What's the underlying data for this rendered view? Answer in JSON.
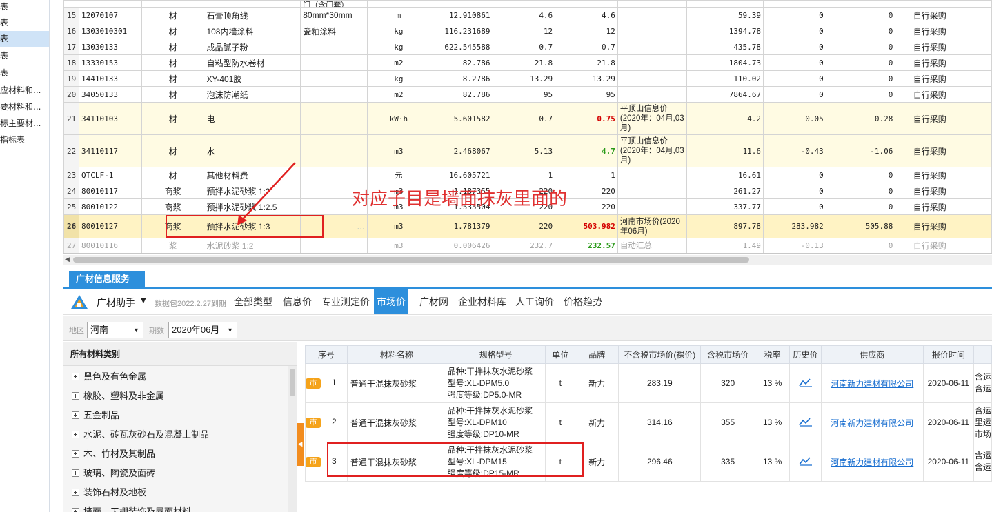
{
  "left_nav": {
    "items": [
      "表",
      "表",
      "表",
      "表",
      "表",
      "应材料和...",
      "要材料和...",
      "标主要材...",
      "指标表"
    ],
    "active_index": 2
  },
  "grid": {
    "partial_top": {
      "spec": "门（含门套）"
    },
    "rows": [
      {
        "idx": "15",
        "code": "12070107",
        "type": "材",
        "name": "石膏顶角线",
        "spec": "80mm*30mm",
        "unit": "m",
        "qty": "12.910861",
        "price1": "4.6",
        "price2": "4.6",
        "source": "",
        "amount": "59.39",
        "diff": "0",
        "diff_total": "0",
        "supply": "自行采购",
        "style": ""
      },
      {
        "idx": "16",
        "code": "1303010301",
        "type": "材",
        "name": "108内墙涂料",
        "spec": "瓷釉涂料",
        "unit": "kg",
        "qty": "116.231689",
        "price1": "12",
        "price2": "12",
        "source": "",
        "amount": "1394.78",
        "diff": "0",
        "diff_total": "0",
        "supply": "自行采购",
        "style": ""
      },
      {
        "idx": "17",
        "code": "13030133",
        "type": "材",
        "name": "成品腻子粉",
        "spec": "",
        "unit": "kg",
        "qty": "622.545588",
        "price1": "0.7",
        "price2": "0.7",
        "source": "",
        "amount": "435.78",
        "diff": "0",
        "diff_total": "0",
        "supply": "自行采购",
        "style": ""
      },
      {
        "idx": "18",
        "code": "13330153",
        "type": "材",
        "name": "自粘型防水卷材",
        "spec": "",
        "unit": "m2",
        "qty": "82.786",
        "price1": "21.8",
        "price2": "21.8",
        "source": "",
        "amount": "1804.73",
        "diff": "0",
        "diff_total": "0",
        "supply": "自行采购",
        "style": ""
      },
      {
        "idx": "19",
        "code": "14410133",
        "type": "材",
        "name": "XY-401胶",
        "spec": "",
        "unit": "kg",
        "qty": "8.2786",
        "price1": "13.29",
        "price2": "13.29",
        "source": "",
        "amount": "110.02",
        "diff": "0",
        "diff_total": "0",
        "supply": "自行采购",
        "style": ""
      },
      {
        "idx": "20",
        "code": "34050133",
        "type": "材",
        "name": "泡沫防潮纸",
        "spec": "",
        "unit": "m2",
        "qty": "82.786",
        "price1": "95",
        "price2": "95",
        "source": "",
        "amount": "7864.67",
        "diff": "0",
        "diff_total": "0",
        "supply": "自行采购",
        "style": ""
      },
      {
        "idx": "21",
        "code": "34110103",
        "type": "材",
        "name": "电",
        "spec": "",
        "unit": "kW·h",
        "qty": "5.601582",
        "price1": "0.7",
        "price2": "0.75",
        "source": "平顶山信息价(2020年：04月,03月)",
        "amount": "4.2",
        "diff": "0.05",
        "diff_total": "0.28",
        "supply": "自行采购",
        "style": "yellow",
        "p2color": "red"
      },
      {
        "idx": "22",
        "code": "34110117",
        "type": "材",
        "name": "水",
        "spec": "",
        "unit": "m3",
        "qty": "2.468067",
        "price1": "5.13",
        "price2": "4.7",
        "source": "平顶山信息价(2020年：04月,03月)",
        "amount": "11.6",
        "diff": "-0.43",
        "diff_total": "-1.06",
        "supply": "自行采购",
        "style": "yellow",
        "p2color": "green"
      },
      {
        "idx": "23",
        "code": "QTCLF-1",
        "type": "材",
        "name": "其他材料费",
        "spec": "",
        "unit": "元",
        "qty": "16.605721",
        "price1": "1",
        "price2": "1",
        "source": "",
        "amount": "16.61",
        "diff": "0",
        "diff_total": "0",
        "supply": "自行采购",
        "style": ""
      },
      {
        "idx": "24",
        "code": "80010117",
        "type": "商浆",
        "name": "预拌水泥砂浆 1:2",
        "spec": "",
        "unit": "m3",
        "qty": "1.187355",
        "price1": "220",
        "price2": "220",
        "source": "",
        "amount": "261.27",
        "diff": "0",
        "diff_total": "0",
        "supply": "自行采购",
        "style": ""
      },
      {
        "idx": "25",
        "code": "80010122",
        "type": "商浆",
        "name": "预拌水泥砂浆 1:2.5",
        "spec": "",
        "unit": "m3",
        "qty": "1.535504",
        "price1": "220",
        "price2": "220",
        "source": "",
        "amount": "337.77",
        "diff": "0",
        "diff_total": "0",
        "supply": "自行采购",
        "style": ""
      },
      {
        "idx": "26",
        "code": "80010127",
        "type": "商浆",
        "name": "预拌水泥砂浆 1:3",
        "spec": "…",
        "unit": "m3",
        "qty": "1.781379",
        "price1": "220",
        "price2": "503.982",
        "source": "河南市场价(2020年06月)",
        "amount": "897.78",
        "diff": "283.982",
        "diff_total": "505.88",
        "supply": "自行采购",
        "style": "selected",
        "p2color": "red"
      },
      {
        "idx": "27",
        "code": "80010116",
        "type": "浆",
        "name": "水泥砂浆 1:2",
        "spec": "",
        "unit": "m3",
        "qty": "0.006426",
        "price1": "232.7",
        "price2": "232.57",
        "source": "自动汇总",
        "amount": "1.49",
        "diff": "-0.13",
        "diff_total": "0",
        "supply": "自行采购",
        "style": "gray",
        "p2color": "green"
      }
    ]
  },
  "annotation": {
    "text": "对应子目是墙面抹灰里面的"
  },
  "service": {
    "tab_label": "广材信息服务",
    "helper_label": "广材助手",
    "package_note": "数据包2022.2.27到期",
    "tabs": [
      "全部类型",
      "信息价",
      "专业测定价",
      "市场价",
      "广材网",
      "企业材料库",
      "人工询价",
      "价格趋势"
    ],
    "active_tab": 3,
    "filter": {
      "region_label": "地区",
      "region_value": "河南",
      "period_label": "期数",
      "period_value": "2020年06月"
    }
  },
  "categories": {
    "header": "所有材料类别",
    "items": [
      "黑色及有色金属",
      "橡胶、塑料及非金属",
      "五金制品",
      "水泥、砖瓦灰砂石及混凝土制品",
      "木、竹材及其制品",
      "玻璃、陶瓷及面砖",
      "装饰石材及地板",
      "墙面、天棚装饰及屋面材料"
    ]
  },
  "results": {
    "headers": [
      "序号",
      "材料名称",
      "规格型号",
      "单位",
      "品牌",
      "不含税市场价(裸价)",
      "含税市场价",
      "税率",
      "历史价",
      "供应商",
      "报价时间",
      ""
    ],
    "badge": "市",
    "rows": [
      {
        "no": "1",
        "name": "普通干混抹灰砂浆",
        "spec": [
          "品种:干拌抹灰水泥砂浆",
          "型号:XL-DPM5.0",
          "强度等级:DP5.0-MR"
        ],
        "unit": "t",
        "brand": "新力",
        "price_ex": "283.19",
        "price_in": "320",
        "tax": "13 %",
        "supplier": "河南新力建材有限公司",
        "date": "2020-06-11",
        "extra": [
          "含运",
          "含运"
        ]
      },
      {
        "no": "2",
        "name": "普通干混抹灰砂浆",
        "spec": [
          "品种:干拌抹灰水泥砂浆",
          "型号:XL-DPM10",
          "强度等级:DP10-MR"
        ],
        "unit": "t",
        "brand": "新力",
        "price_ex": "314.16",
        "price_in": "355",
        "tax": "13 %",
        "supplier": "河南新力建材有限公司",
        "date": "2020-06-11",
        "extra": [
          "含运",
          "里运",
          "市场"
        ]
      },
      {
        "no": "3",
        "name": "普通干混抹灰砂浆",
        "spec": [
          "品种:干拌抹灰水泥砂浆",
          "型号:XL-DPM15",
          "强度等级:DP15-MR"
        ],
        "unit": "t",
        "brand": "新力",
        "price_ex": "296.46",
        "price_in": "335",
        "tax": "13 %",
        "supplier": "河南新力建材有限公司",
        "date": "2020-06-11",
        "extra": [
          "含运",
          "含运"
        ]
      }
    ]
  },
  "colors": {
    "accent": "#2d8fdc",
    "badge": "#f5a31a",
    "annotation": "#e03030"
  }
}
